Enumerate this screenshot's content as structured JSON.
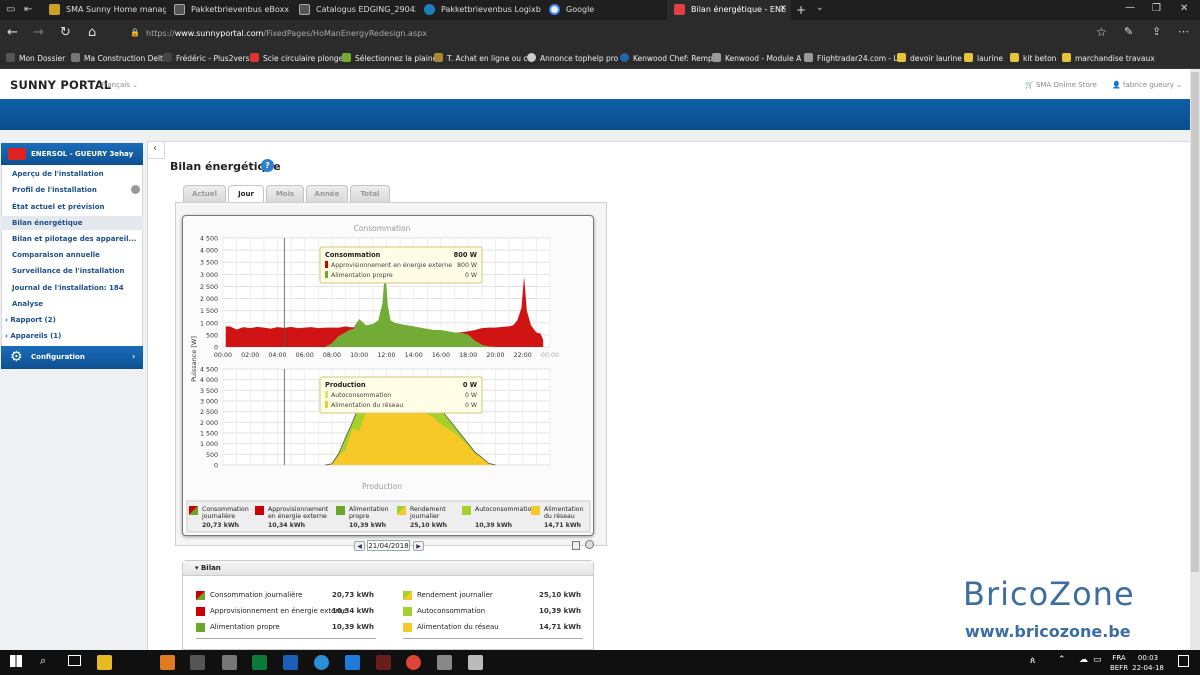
{
  "browser": {
    "tabs": [
      {
        "label": "SMA Sunny Home manager",
        "icon": "bz-icon"
      },
      {
        "label": "Pakketbrievenbus eBoxx EA",
        "icon": "page-icon"
      },
      {
        "label": "Catalogus EDGING_290420",
        "icon": "page-icon"
      },
      {
        "label": "Pakketbrievenbus Logixbox",
        "icon": "b-icon"
      },
      {
        "label": "Google",
        "icon": "google-icon"
      },
      {
        "label": "Bilan énergétique - ENE",
        "icon": "sma-icon"
      }
    ],
    "url_prefix": "https://",
    "url_domain": "www.sunnyportal.com",
    "url_path": "/FixedPages/HoManEnergyRedesign.aspx",
    "favorites": [
      "Mon Dossier",
      "Ma Construction Delt",
      "Frédéric - Plus2vers",
      "Scie circulaire plonge",
      "Sélectionnez la plaine",
      "T. Achat en ligne ou c",
      "Annonce tophelp pro",
      "Kenwood Chef: Remp",
      "Kenwood - Module A",
      "Flightradar24.com - L",
      "devoir laurine",
      "laurine",
      "kit beton",
      "marchandise travaux"
    ]
  },
  "portal": {
    "logo": "SUNNY PORTAL",
    "language": "Français",
    "store": "SMA Online Store",
    "user": "fabrice gueury",
    "plant_name": "ENERSOL - GUEURY 3ehay",
    "nav": [
      {
        "label": "Aperçu de l'installation"
      },
      {
        "label": "Profil de l'installation"
      },
      {
        "label": "État actuel et prévision"
      },
      {
        "label": "Bilan énergétique"
      },
      {
        "label": "Bilan et pilotage des appareil..."
      },
      {
        "label": "Comparaison annuelle"
      },
      {
        "label": "Surveillance de l'installation"
      },
      {
        "label": "Journal de l'installation: 184"
      },
      {
        "label": "Analyse"
      },
      {
        "label": "Rapport (2)"
      },
      {
        "label": "Appareils (1)"
      }
    ],
    "config": "Configuration",
    "page_title": "Bilan énergétique",
    "help": "?",
    "period_tabs": [
      "Actuel",
      "Jour",
      "Mois",
      "Année",
      "Total"
    ],
    "date": "21/04/2018"
  },
  "chart_data": [
    {
      "type": "area",
      "title": "Consommation",
      "ylabel": "Puissance [W]",
      "ylim": [
        0,
        4500
      ],
      "yticks": [
        "4 500",
        "4 000",
        "3 500",
        "3 000",
        "2 500",
        "2 000",
        "1 500",
        "1 000",
        "500",
        "0"
      ],
      "xticks": [
        "00:00",
        "02:00",
        "04:00",
        "06:00",
        "08:00",
        "10:00",
        "12:00",
        "14:00",
        "16:00",
        "18:00",
        "20:00",
        "22:00",
        "00:00"
      ],
      "x_hours": [
        0.2,
        0.5,
        1,
        1.5,
        2,
        2.5,
        3,
        3.5,
        4,
        4.5,
        5,
        5.5,
        6,
        6.5,
        7,
        7.5,
        8,
        8.5,
        9,
        9.3,
        9.6,
        10,
        10.5,
        11,
        11.4,
        11.7,
        11.9,
        12.1,
        12.3,
        12.6,
        13,
        13.5,
        14,
        14.5,
        15,
        15.5,
        16,
        16.5,
        17,
        17.5,
        18,
        18.5,
        19,
        19.5,
        20,
        20.5,
        21,
        21.3,
        21.6,
        21.9,
        22.1,
        22.3,
        22.6,
        23,
        23.3,
        23.5
      ],
      "series": [
        {
          "name": "Approvisionnement en énergie externe",
          "color": "#cc0000",
          "values": [
            850,
            850,
            720,
            820,
            780,
            830,
            800,
            760,
            820,
            790,
            830,
            780,
            800,
            820,
            780,
            800,
            650,
            350,
            250,
            120,
            60,
            0,
            0,
            0,
            0,
            0,
            0,
            0,
            0,
            0,
            0,
            0,
            0,
            0,
            0,
            0,
            0,
            0,
            0,
            30,
            150,
            450,
            700,
            780,
            800,
            830,
            850,
            900,
            1100,
            1600,
            2900,
            1500,
            900,
            600,
            550,
            300
          ]
        },
        {
          "name": "Alimentation propre",
          "color": "#6aa82c",
          "values": [
            0,
            0,
            0,
            0,
            0,
            0,
            0,
            0,
            0,
            0,
            0,
            0,
            0,
            0,
            0,
            0,
            150,
            450,
            600,
            700,
            750,
            1150,
            900,
            950,
            1100,
            1800,
            3200,
            1700,
            1100,
            1000,
            950,
            900,
            850,
            800,
            750,
            700,
            700,
            650,
            600,
            580,
            500,
            250,
            80,
            20,
            0,
            0,
            0,
            0,
            0,
            0,
            0,
            0,
            0,
            0,
            0,
            0
          ]
        }
      ],
      "tooltip": {
        "title": "Consommation",
        "title_value": "800 W",
        "rows": [
          {
            "label": "Approvisionnement en énergie externe",
            "value": "800 W",
            "color": "#cc0000"
          },
          {
            "label": "Alimentation propre",
            "value": "0 W",
            "color": "#6aa82c"
          }
        ]
      }
    },
    {
      "type": "area",
      "title": "Production",
      "ylabel": "Puissance [W]",
      "ylim": [
        0,
        4500
      ],
      "yticks": [
        "4 500",
        "4 000",
        "3 500",
        "3 000",
        "2 500",
        "2 000",
        "1 500",
        "1 000",
        "500",
        "0"
      ],
      "x_hours": [
        7.5,
        8,
        8.5,
        9,
        9.5,
        10,
        10.5,
        11,
        11.5,
        12,
        12.5,
        13,
        13.5,
        14,
        14.5,
        15,
        15.5,
        16,
        16.5,
        17,
        17.5,
        18,
        18.5,
        19,
        19.5,
        20
      ],
      "series": [
        {
          "name": "Autoconsommation",
          "color": "#a6d12c",
          "values": [
            0,
            0,
            50,
            0,
            0,
            0,
            0,
            0,
            0,
            0,
            0,
            0,
            0,
            0,
            0,
            0,
            0,
            0,
            0,
            0,
            0,
            0,
            0,
            0,
            0,
            0
          ]
        },
        {
          "name": "Alimentation du réseau",
          "color": "#f7c928",
          "values": [
            0,
            20,
            450,
            700,
            1700,
            1600,
            2500,
            2600,
            2700,
            3000,
            3300,
            3100,
            3100,
            3000,
            2600,
            2400,
            2200,
            1900,
            1700,
            1500,
            1200,
            900,
            500,
            350,
            80,
            0
          ]
        },
        {
          "name": "Rendement journalier",
          "color": "#a6d12c",
          "values": [
            0,
            60,
            550,
            1300,
            2000,
            2800,
            3200,
            3600,
            3800,
            3900,
            3850,
            3850,
            3800,
            3700,
            3400,
            3200,
            2900,
            2600,
            2200,
            1800,
            1400,
            1000,
            600,
            350,
            80,
            0
          ]
        }
      ],
      "tooltip": {
        "title": "Production",
        "title_value": "0 W",
        "rows": [
          {
            "label": "Autoconsommation",
            "value": "0 W",
            "color": "#a6d12c"
          },
          {
            "label": "Alimentation du réseau",
            "value": "0 W",
            "color": "#f7c928"
          }
        ]
      }
    }
  ],
  "legend": [
    {
      "label1": "Consommation",
      "label2": "journalière",
      "value": "20,73 kWh",
      "color": "split"
    },
    {
      "label1": "Approvisionnement",
      "label2": "en énergie externe",
      "value": "10,34 kWh",
      "color": "#cc0000"
    },
    {
      "label1": "Alimentation",
      "label2": "propre",
      "value": "10,39 kWh",
      "color": "#6aa82c"
    },
    {
      "label1": "Rendement",
      "label2": "journalier",
      "value": "25,10 kWh",
      "color": "splity"
    },
    {
      "label1": "Autoconsommation",
      "label2": "",
      "value": "10,39 kWh",
      "color": "#a6d12c"
    },
    {
      "label1": "Alimentation",
      "label2": "du réseau",
      "value": "14,71 kWh",
      "color": "#f7c928"
    }
  ],
  "bilan": {
    "title": "Bilan",
    "left": [
      {
        "label": "Consommation journalière",
        "value": "20,73 kWh"
      },
      {
        "label": "Approvisionnement en énergie externe",
        "value": "10,34 kWh"
      },
      {
        "label": "Alimentation propre",
        "value": "10,39 kWh"
      }
    ],
    "right": [
      {
        "label": "Rendement journalier",
        "value": "25,10 kWh"
      },
      {
        "label": "Autoconsommation",
        "value": "10,39 kWh"
      },
      {
        "label": "Alimentation du réseau",
        "value": "14,71 kWh"
      }
    ]
  },
  "watermark": {
    "line1": "BricoZone",
    "line2": "www.bricozone.be"
  },
  "taskbar": {
    "lang": "FRA",
    "region": "BEFR",
    "time": "00:03",
    "date": "22-04-18"
  }
}
